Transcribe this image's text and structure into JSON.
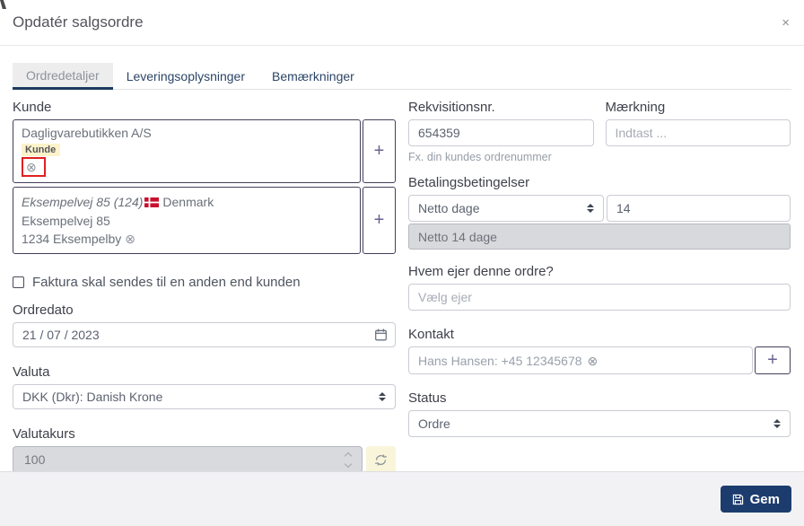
{
  "colors": {
    "primary_button": "#1d3c6e",
    "dark_border": "#443f5b",
    "annotation_red": "#e01f1f",
    "badge_yellow": "#fcf3cb",
    "refresh_yellow": "#f9f5da",
    "disabled_gray": "#d9dade",
    "tab_underline": "#1c3a5e"
  },
  "icons": {
    "close": "×",
    "plus": "+",
    "remove": "⊗"
  },
  "modal": {
    "title": "Opdatér salgsordre"
  },
  "tabs": [
    {
      "label": "Ordredetaljer",
      "active": true
    },
    {
      "label": "Leveringsoplysninger",
      "active": false
    },
    {
      "label": "Bemærkninger",
      "active": false
    }
  ],
  "left": {
    "kunde_label": "Kunde",
    "customer": {
      "name": "Dagligvarebutikken A/S",
      "badge": "Kunde"
    },
    "address": {
      "line1_italic": "Eksempelvej 85 (124)",
      "country": "Denmark",
      "line2": "Eksempelvej 85",
      "line3": "1234 Eksempelby"
    },
    "invoice_checkbox_label": "Faktura skal sendes til en anden end kunden",
    "ordredato_label": "Ordredato",
    "ordredato_value": "21 / 07 / 2023",
    "valuta_label": "Valuta",
    "valuta_value": "DKK (Dkr): Danish Krone",
    "valutakurs_label": "Valutakurs",
    "valutakurs_value": "100"
  },
  "right": {
    "rekvisition_label": "Rekvisitionsnr.",
    "rekvisition_value": "654359",
    "rekvisition_helper": "Fx. din kundes ordrenummer",
    "maerkning_label": "Mærkning",
    "maerkning_placeholder": "Indtast ...",
    "betaling_label": "Betalingsbetingelser",
    "betaling_type": "Netto dage",
    "betaling_days": "14",
    "betaling_summary": "Netto 14 dage",
    "owner_label": "Hvem ejer denne ordre?",
    "owner_placeholder": "Vælg ejer",
    "kontakt_label": "Kontakt",
    "kontakt_value": "Hans Hansen: +45 12345678",
    "status_label": "Status",
    "status_value": "Ordre"
  },
  "footer": {
    "save_label": "Gem"
  }
}
